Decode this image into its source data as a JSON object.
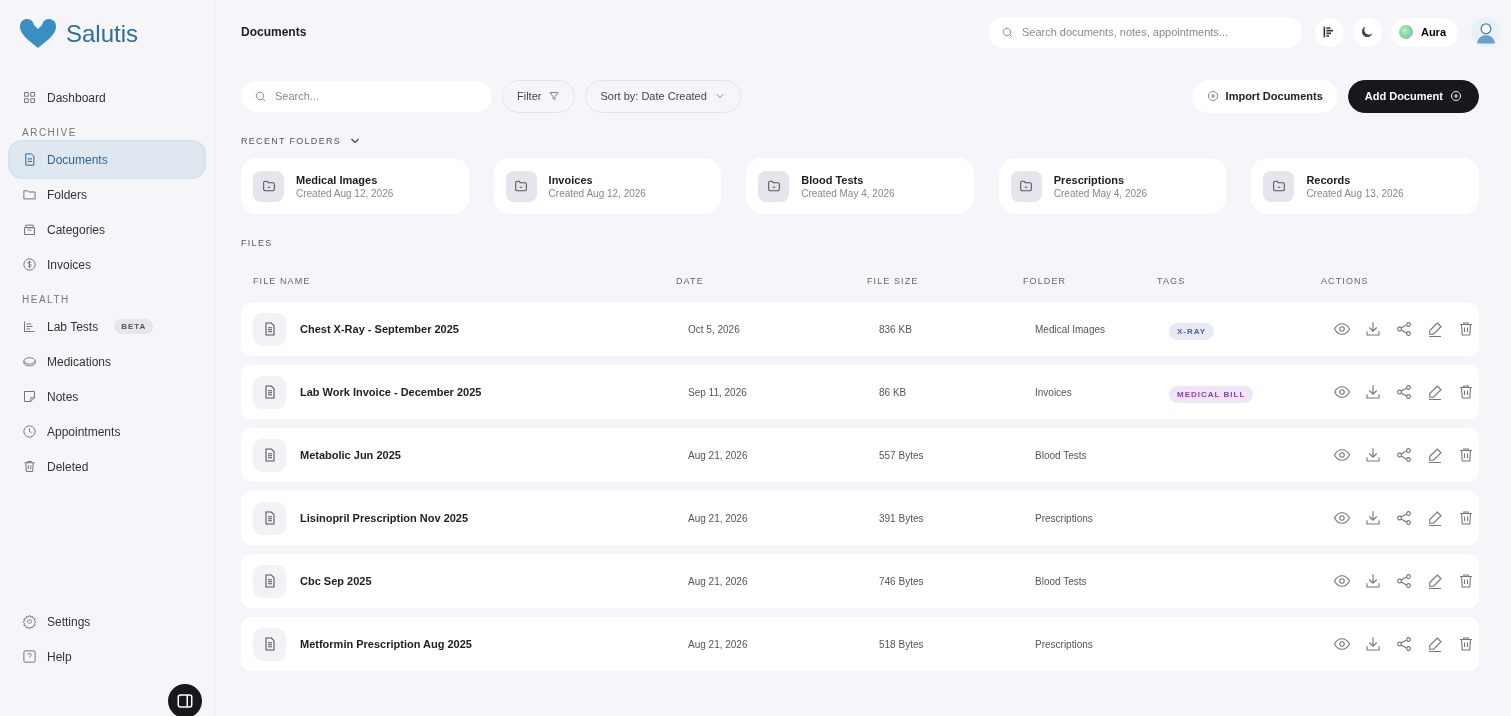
{
  "sidebar": {
    "logo": "Salutis",
    "nav": [
      {
        "kind": "link",
        "label": "Dashboard",
        "selected": false
      },
      {
        "kind": "section",
        "label": "ARCHIVE"
      },
      {
        "kind": "link",
        "label": "Documents",
        "selected": true
      },
      {
        "kind": "link",
        "label": "Folders",
        "selected": false
      },
      {
        "kind": "link",
        "label": "Categories",
        "selected": false
      },
      {
        "kind": "link",
        "label": "Invoices",
        "selected": false
      },
      {
        "kind": "section",
        "label": "HEALTH"
      },
      {
        "kind": "link",
        "label": "Lab Tests",
        "selected": false,
        "badge": "BETA"
      },
      {
        "kind": "link",
        "label": "Medications",
        "selected": false
      },
      {
        "kind": "link",
        "label": "Notes",
        "selected": false
      },
      {
        "kind": "link",
        "label": "Appointments",
        "selected": false
      },
      {
        "kind": "link",
        "label": "Deleted",
        "selected": false
      }
    ],
    "footer": [
      {
        "label": "Settings"
      },
      {
        "label": "Help"
      }
    ]
  },
  "header": {
    "title": "Documents",
    "search": {
      "placeholder": "Search documents, notes, appointments..."
    },
    "user": "Aura"
  },
  "toolbar": {
    "search": {
      "placeholder": "Search..."
    },
    "filter": "Filter",
    "sort": "Sort by: Date Created",
    "import": "Import Documents",
    "add": "Add Document"
  },
  "recent_folders": {
    "title": "RECENT FOLDERS",
    "expanded": true,
    "items": [
      {
        "name": "Medical Images",
        "created": "Created Aug 12, 2026"
      },
      {
        "name": "Invoices",
        "created": "Created Aug 12, 2026"
      },
      {
        "name": "Blood Tests",
        "created": "Created May 4, 2026"
      },
      {
        "name": "Prescriptions",
        "created": "Created May 4, 2026"
      },
      {
        "name": "Records",
        "created": "Created Aug 13, 2026"
      }
    ]
  },
  "files": {
    "title": "FILES",
    "columns": [
      "FILE NAME",
      "DATE",
      "FILE SIZE",
      "FOLDER",
      "TAGS",
      "ACTIONS"
    ],
    "rows": [
      {
        "name": "Chest X-Ray - September 2025",
        "date": "Oct 5, 2026",
        "size": "836 KB",
        "folder": "Medical Images",
        "tag": {
          "label": "X-RAY",
          "color": "#4a5bb0"
        }
      },
      {
        "name": "Lab Work Invoice - December 2025",
        "date": "Sep 11, 2026",
        "size": "86 KB",
        "folder": "Invoices",
        "tag": {
          "label": "MEDICAL BILL",
          "color": "#8a3fb5"
        }
      },
      {
        "name": "Metabolic Jun 2025",
        "date": "Aug 21, 2026",
        "size": "557 Bytes",
        "folder": "Blood Tests"
      },
      {
        "name": "Lisinopril Prescription Nov 2025",
        "date": "Aug 21, 2026",
        "size": "391 Bytes",
        "folder": "Prescriptions"
      },
      {
        "name": "Cbc Sep 2025",
        "date": "Aug 21, 2026",
        "size": "746 Bytes",
        "folder": "Blood Tests"
      },
      {
        "name": "Metformin Prescription Aug 2025",
        "date": "Aug 21, 2026",
        "size": "518 Bytes",
        "folder": "Prescriptions"
      }
    ]
  }
}
